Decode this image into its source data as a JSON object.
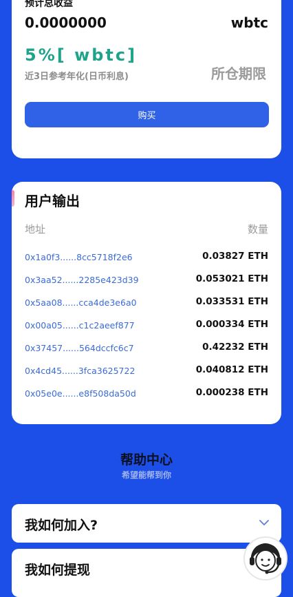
{
  "earnings": {
    "label": "预计总收益",
    "value": "0.0000000",
    "unit": "wbtc",
    "rate": "5%[ wbtc]",
    "rate_caption": "近3日参考年化(日币利息)",
    "lock_period": "所仓期限",
    "buy_label": "购买"
  },
  "output": {
    "title": "用户输出",
    "col_address": "地址",
    "col_amount": "数量",
    "rows": [
      {
        "address": "0x1a0f3......8cc5718f2e6",
        "amount": "0.03827 ETH"
      },
      {
        "address": "0x3aa52......2285e423d39",
        "amount": "0.053021 ETH"
      },
      {
        "address": "0x5aa08......cca4de3e6a0",
        "amount": "0.033531 ETH"
      },
      {
        "address": "0x00a05......c1c2aeef877",
        "amount": "0.000334 ETH"
      },
      {
        "address": "0x37457......564dccfc6c7",
        "amount": "0.42232 ETH"
      },
      {
        "address": "0x4cd45......3fca3625722",
        "amount": "0.040812 ETH"
      },
      {
        "address": "0x05e0e......e8f508da50d",
        "amount": "0.000238 ETH"
      }
    ]
  },
  "help": {
    "title": "帮助中心",
    "subtitle": "希望能帮到你",
    "faq": [
      {
        "question": "我如何加入?"
      },
      {
        "question": "我如何提现"
      }
    ]
  },
  "colors": {
    "background": "#1c4ee8",
    "accent_green": "#1fa38a",
    "button_blue": "#2f62e6",
    "address_blue": "#3a6bd6"
  },
  "icons": {
    "faq_expand": "chevron-down-icon",
    "support": "customer-support-icon"
  }
}
